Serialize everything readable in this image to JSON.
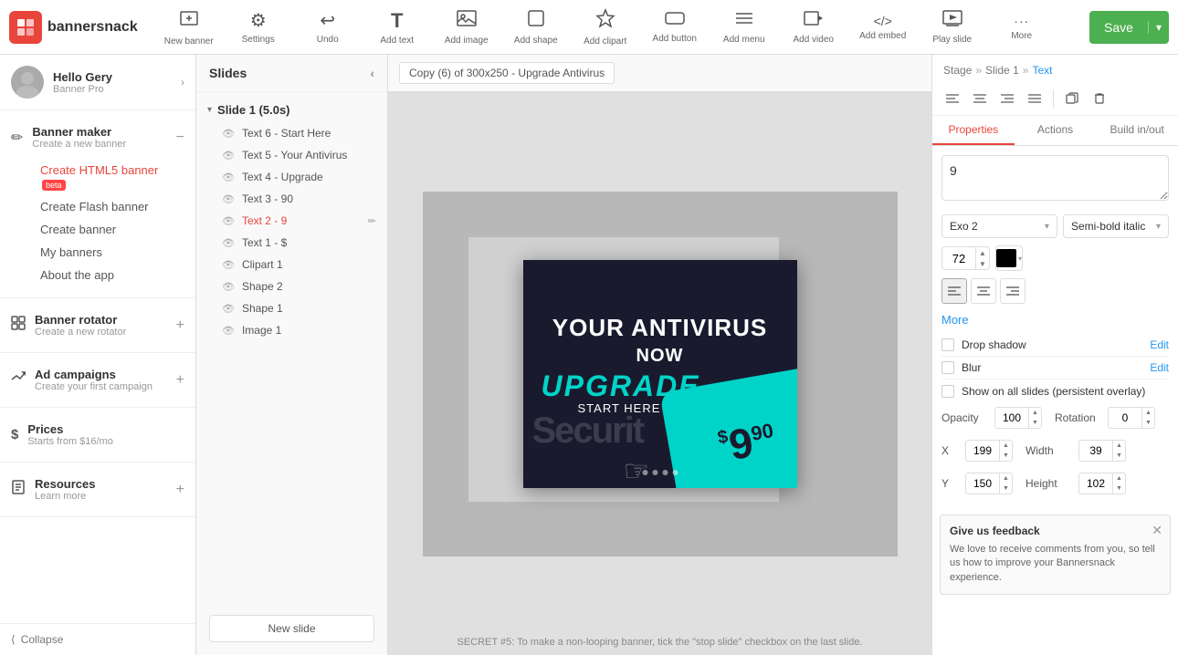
{
  "app": {
    "logo_text": "bannersnack",
    "logo_letter": "bs"
  },
  "toolbar": {
    "items": [
      {
        "id": "new-banner",
        "label": "New banner",
        "icon": "⊕"
      },
      {
        "id": "settings",
        "label": "Settings",
        "icon": "⚙"
      },
      {
        "id": "undo",
        "label": "Undo",
        "icon": "↩"
      },
      {
        "id": "add-text",
        "label": "Add text",
        "icon": "T"
      },
      {
        "id": "add-image",
        "label": "Add image",
        "icon": "🖼"
      },
      {
        "id": "add-shape",
        "label": "Add shape",
        "icon": "◻"
      },
      {
        "id": "add-clipart",
        "label": "Add clipart",
        "icon": "★"
      },
      {
        "id": "add-button",
        "label": "Add button",
        "icon": "▭"
      },
      {
        "id": "add-menu",
        "label": "Add menu",
        "icon": "☰"
      },
      {
        "id": "add-video",
        "label": "Add video",
        "icon": "▶"
      },
      {
        "id": "add-embed",
        "label": "Add embed",
        "icon": "<>"
      },
      {
        "id": "play-slide",
        "label": "Play slide",
        "icon": "▷"
      },
      {
        "id": "more",
        "label": "More",
        "icon": "···"
      }
    ],
    "save_label": "Save",
    "save_arrow": "▾"
  },
  "sidebar": {
    "user": {
      "name": "Hello Gery",
      "plan": "Banner Pro",
      "avatar_letter": "G"
    },
    "sections": [
      {
        "id": "banner-maker",
        "icon": "✏",
        "label": "Banner maker",
        "sub": "Create a new banner",
        "collapsible": true,
        "items": [
          {
            "label": "Create HTML5 banner",
            "badge": "beta",
            "active": false,
            "id": "create-html5"
          },
          {
            "label": "Create Flash banner",
            "active": false,
            "id": "create-flash"
          },
          {
            "label": "Create banner",
            "active": false,
            "id": "create-banner"
          }
        ]
      },
      {
        "id": "about-app",
        "icon": "",
        "label": "About the app",
        "sub": "",
        "collapsible": false,
        "items": []
      },
      {
        "id": "banner-rotator",
        "icon": "▣",
        "label": "Banner rotator",
        "sub": "Create a new rotator",
        "collapsible": false,
        "items": []
      },
      {
        "id": "ad-campaigns",
        "icon": "📢",
        "label": "Ad campaigns",
        "sub": "Create your first campaign",
        "collapsible": false,
        "items": []
      },
      {
        "id": "prices",
        "icon": "$",
        "label": "Prices",
        "sub": "Starts from $16/mo",
        "collapsible": false,
        "items": []
      },
      {
        "id": "resources",
        "icon": "📋",
        "label": "Resources",
        "sub": "Learn more",
        "collapsible": false,
        "items": []
      }
    ],
    "collapse_label": "Collapse",
    "my_banners": "My banners",
    "about_app": "About the app"
  },
  "slides_panel": {
    "title": "Slides",
    "slide_group": {
      "label": "Slide 1 (5.0s)",
      "items": [
        {
          "id": "text6",
          "label": "Text 6 - Start Here",
          "active": false
        },
        {
          "id": "text5",
          "label": "Text 5 - Your Antivirus",
          "active": false
        },
        {
          "id": "text4",
          "label": "Text 4 - Upgrade",
          "active": false
        },
        {
          "id": "text3",
          "label": "Text 3 - 90",
          "active": false
        },
        {
          "id": "text2",
          "label": "Text 2 - 9",
          "active": true
        },
        {
          "id": "text1",
          "label": "Text 1 - $",
          "active": false
        },
        {
          "id": "clipart1",
          "label": "Clipart 1",
          "active": false
        },
        {
          "id": "shape2",
          "label": "Shape 2",
          "active": false
        },
        {
          "id": "shape1",
          "label": "Shape 1",
          "active": false
        },
        {
          "id": "image1",
          "label": "Image 1",
          "active": false
        }
      ]
    },
    "new_slide_label": "New slide"
  },
  "canvas": {
    "label": "Copy (6) of 300x250 - Upgrade Antivirus",
    "hint": "SECRET #5: To make a non-looping banner, tick the \"stop slide\" checkbox on the last slide.",
    "banner": {
      "text_main": "YOUR ANTIVIRUS",
      "text_sub": "NOW",
      "text_upgrade": "UPGRADE",
      "text_start": "START HERE",
      "security_text": "Securit",
      "price": "9",
      "price_sup": "$",
      "price_sup2": "90",
      "dots": [
        1,
        2,
        3,
        4
      ]
    }
  },
  "right_panel": {
    "breadcrumb": {
      "stage": "Stage",
      "slide": "Slide 1",
      "text": "Text"
    },
    "toolbar_buttons": [
      "≡",
      "≡",
      "≡",
      "≡",
      "⊡",
      "🗑"
    ],
    "tabs": [
      {
        "id": "properties",
        "label": "Properties",
        "active": true
      },
      {
        "id": "actions",
        "label": "Actions",
        "active": false
      },
      {
        "id": "build-inout",
        "label": "Build in/out",
        "active": false
      }
    ],
    "text_content": "9",
    "font": {
      "family": "Exo 2",
      "style": "Semi-bold italic"
    },
    "size": "72",
    "color": "#000000",
    "align_buttons": [
      {
        "id": "align-left",
        "icon": "≡",
        "active": true
      },
      {
        "id": "align-center",
        "icon": "≡",
        "active": false
      },
      {
        "id": "align-right",
        "icon": "≡",
        "active": false
      }
    ],
    "more_label": "More",
    "drop_shadow": {
      "label": "Drop shadow",
      "edit_label": "Edit",
      "checked": false
    },
    "blur": {
      "label": "Blur",
      "edit_label": "Edit",
      "checked": false
    },
    "persistent": {
      "label": "Show on all slides (persistent overlay)",
      "checked": false
    },
    "opacity": {
      "label": "Opacity",
      "value": "100"
    },
    "rotation": {
      "label": "Rotation",
      "value": "0"
    },
    "x": {
      "label": "X",
      "value": "199"
    },
    "width": {
      "label": "Width",
      "value": "39"
    },
    "y": {
      "label": "Y",
      "value": "150"
    },
    "height": {
      "label": "Height",
      "value": "102"
    },
    "feedback": {
      "title": "Give us feedback",
      "text": "We love to receive comments from you, so tell us how to improve your Bannersnack experience."
    }
  }
}
